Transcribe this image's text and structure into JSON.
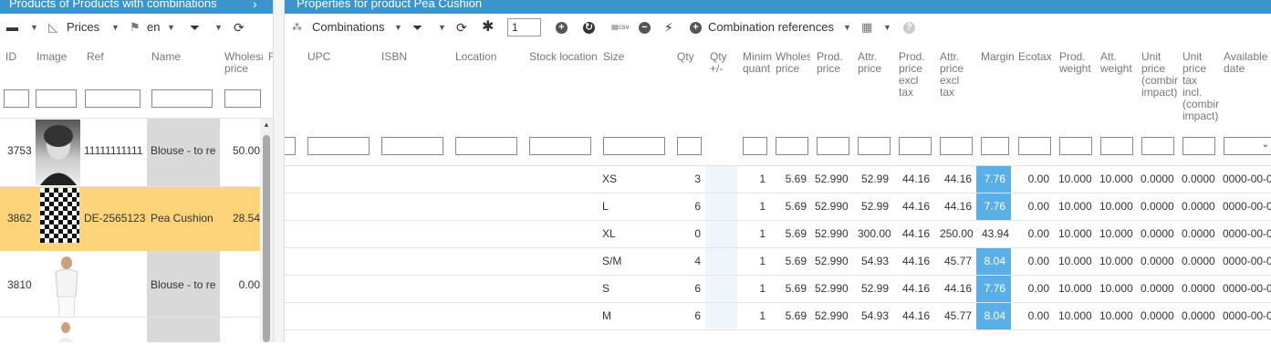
{
  "left_panel": {
    "title": "Products of Products with combinations",
    "toolbar": {
      "prices_label": "Prices",
      "lang_label": "en"
    },
    "columns": [
      "ID",
      "Image",
      "Ref",
      "Name",
      "Wholesale price",
      "F"
    ],
    "rows": [
      {
        "id": "3753",
        "ref": "11111111111",
        "name": "Blouse - to re",
        "price": "50.00"
      },
      {
        "id": "3862",
        "ref": "DE-2565123",
        "name": "Pea Cushion",
        "price": "28.54"
      },
      {
        "id": "3810",
        "ref": "",
        "name": "Blouse - to re",
        "price": "0.00"
      },
      {
        "id": "",
        "ref": "",
        "name": "",
        "price": ""
      }
    ]
  },
  "right_panel": {
    "title": "Properties for product Pea Cushion",
    "toolbar": {
      "combinations_label": "Combinations",
      "page_input": "1",
      "combination_refs_label": "Combination references"
    },
    "columns": {
      "upc": "UPC",
      "isbn": "ISBN",
      "location": "Location",
      "stock_location": "Stock location",
      "size": "Size",
      "qty": "Qty",
      "qty_pm": "Qty +/-",
      "min_qty": "Minim quant",
      "wholesale": "Wholes price",
      "prod_price": "Prod. price",
      "attr_price": "Attr. price",
      "prod_price_excl": "Prod. price excl tax",
      "attr_price_excl": "Attr. price excl tax",
      "margin": "Margin",
      "ecotax": "Ecotax",
      "prod_weight": "Prod. weight",
      "att_weight": "Att. weight",
      "unit_price_impact": "Unit price (combir impact)",
      "unit_price_tax": "Unit price tax incl. (combir impact)",
      "available_date": "Available date"
    },
    "rows": [
      {
        "size": "XS",
        "qty": "3",
        "min": "1",
        "wholesale": "5.69",
        "prod_price": "52.990",
        "attr_price": "52.99",
        "prod_excl": "44.16",
        "attr_excl": "44.16",
        "margin": "7.76",
        "ecotax": "0.00",
        "prod_weight": "10.000",
        "att_weight": "10.000",
        "unit_impact": "0.0000",
        "unit_tax": "0.0000",
        "date": "0000-00-0",
        "highlight": true
      },
      {
        "size": "L",
        "qty": "6",
        "min": "1",
        "wholesale": "5.69",
        "prod_price": "52.990",
        "attr_price": "52.99",
        "prod_excl": "44.16",
        "attr_excl": "44.16",
        "margin": "7.76",
        "ecotax": "0.00",
        "prod_weight": "10.000",
        "att_weight": "10.000",
        "unit_impact": "0.0000",
        "unit_tax": "0.0000",
        "date": "0000-00-0",
        "highlight": true
      },
      {
        "size": "XL",
        "qty": "0",
        "min": "1",
        "wholesale": "5.69",
        "prod_price": "52.990",
        "attr_price": "300.00",
        "prod_excl": "44.16",
        "attr_excl": "250.00",
        "margin": "43.94",
        "ecotax": "0.00",
        "prod_weight": "10.000",
        "att_weight": "10.000",
        "unit_impact": "0.0000",
        "unit_tax": "0.0000",
        "date": "0000-00-0",
        "highlight": false
      },
      {
        "size": "S/M",
        "qty": "4",
        "min": "1",
        "wholesale": "5.69",
        "prod_price": "52.990",
        "attr_price": "54.93",
        "prod_excl": "44.16",
        "attr_excl": "45.77",
        "margin": "8.04",
        "ecotax": "0.00",
        "prod_weight": "10.000",
        "att_weight": "10.000",
        "unit_impact": "0.0000",
        "unit_tax": "0.0000",
        "date": "0000-00-0",
        "highlight": true
      },
      {
        "size": "S",
        "qty": "6",
        "min": "1",
        "wholesale": "5.69",
        "prod_price": "52.990",
        "attr_price": "52.99",
        "prod_excl": "44.16",
        "attr_excl": "44.16",
        "margin": "7.76",
        "ecotax": "0.00",
        "prod_weight": "10.000",
        "att_weight": "10.000",
        "unit_impact": "0.0000",
        "unit_tax": "0.0000",
        "date": "0000-00-0",
        "highlight": true
      },
      {
        "size": "M",
        "qty": "6",
        "min": "1",
        "wholesale": "5.69",
        "prod_price": "52.990",
        "attr_price": "54.93",
        "prod_excl": "44.16",
        "attr_excl": "45.77",
        "margin": "8.04",
        "ecotax": "0.00",
        "prod_weight": "10.000",
        "att_weight": "10.000",
        "unit_impact": "0.0000",
        "unit_tax": "0.0000",
        "date": "0000-00-0",
        "highlight": true
      }
    ]
  },
  "colors": {
    "header_bg": "#3a95cf",
    "selected_row": "#fdd47a",
    "margin_highlight": "#5ab0e6",
    "name_col": "#d9d9d9"
  },
  "icons": [
    "table-icon",
    "chart-icon",
    "flag-icon",
    "filter-icon",
    "refresh-icon",
    "combinations-icon",
    "asterisk-icon",
    "add-icon",
    "export-icon",
    "csv-icon",
    "remove-icon",
    "bolt-icon",
    "grid-icon",
    "help-icon"
  ]
}
